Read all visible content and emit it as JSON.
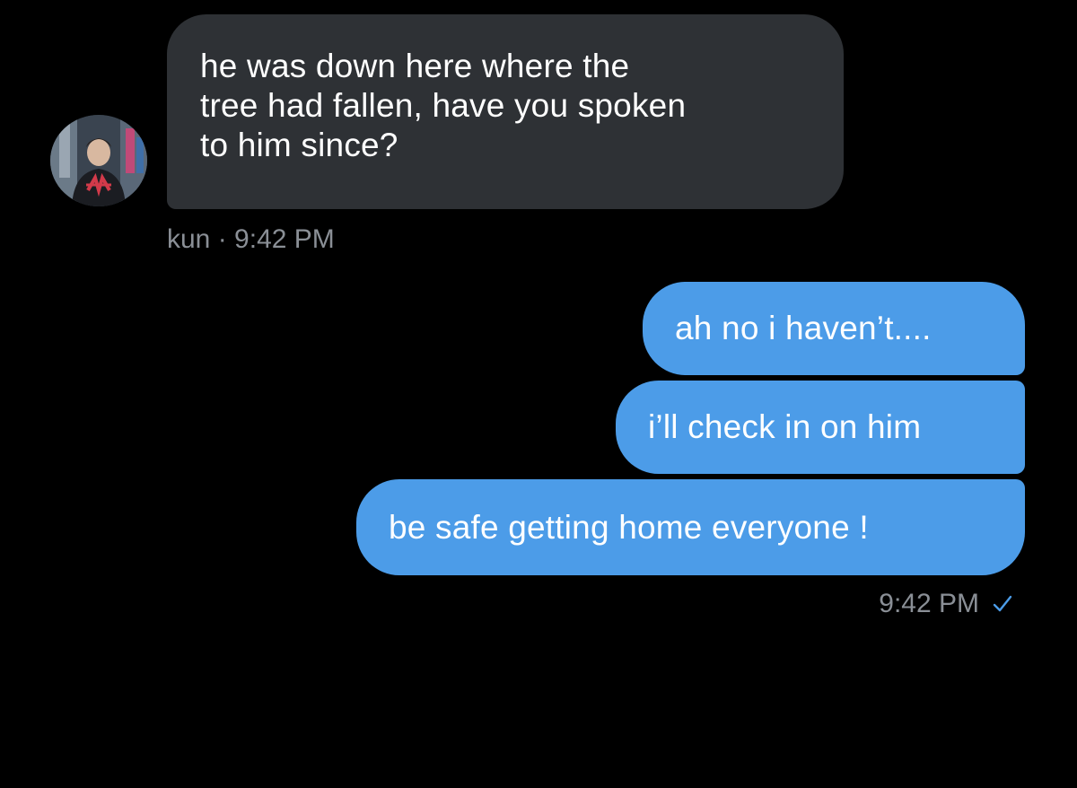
{
  "conversation": {
    "incoming": {
      "sender": "kun",
      "lines": [
        "he was down here where the",
        "tree had fallen, have you spoken",
        "to him since?"
      ],
      "meta_separator": " · ",
      "time": "9:42 PM",
      "avatar_icon": "profile-photo-avatar"
    },
    "outgoing": {
      "messages": [
        "ah no i haven’t....",
        "i’ll check in on him",
        "be safe getting home everyone !"
      ],
      "time": "9:42 PM",
      "status_icon": "checkmark-icon"
    }
  },
  "colors": {
    "background": "#000000",
    "incoming_bubble": "#2e3135",
    "outgoing_bubble": "#4c9ce8",
    "meta_text": "#8a8f96",
    "checkmark": "#4c9ce8"
  }
}
